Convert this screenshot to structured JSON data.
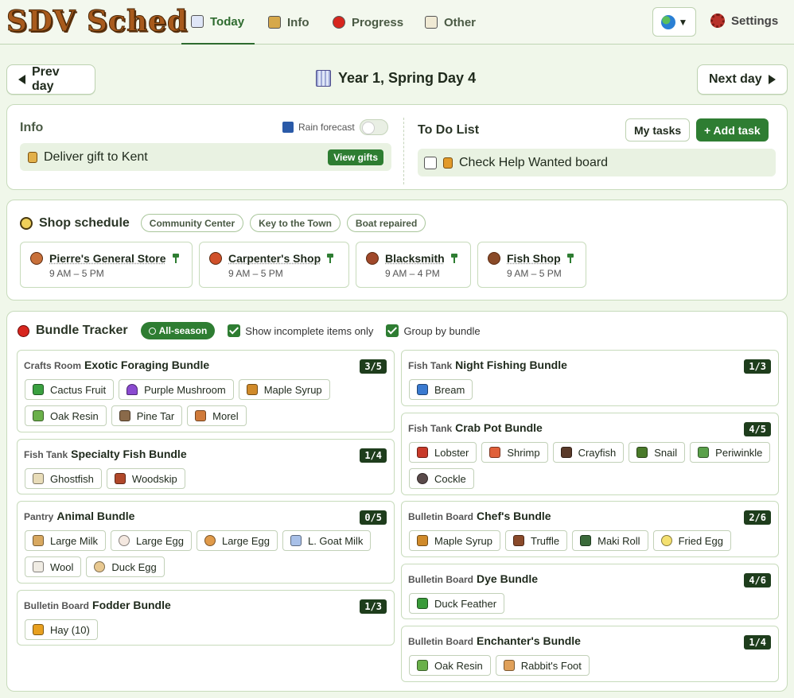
{
  "app": {
    "logo": "SDV Sched"
  },
  "nav": {
    "tabs": [
      {
        "label": "Today",
        "icon": "calendar-icon",
        "color": "#9aa3d6"
      },
      {
        "label": "Info",
        "icon": "scroll-icon",
        "color": "#d6a84a"
      },
      {
        "label": "Progress",
        "icon": "red-ball-icon",
        "color": "#d7261e"
      },
      {
        "label": "Other",
        "icon": "speech-bubble-icon",
        "color": "#e8e0c8"
      }
    ],
    "settings": "Settings"
  },
  "daybar": {
    "prev": "Prev day",
    "next": "Next day",
    "date": "Year 1, Spring Day 4"
  },
  "info": {
    "title": "Info",
    "rain_label": "Rain forecast",
    "rain_on": false,
    "gift_text": "Deliver gift to Kent",
    "view_gifts": "View gifts"
  },
  "todo": {
    "title": "To Do List",
    "my_tasks": "My tasks",
    "add_task": "+  Add task",
    "items": [
      {
        "label": "Check Help Wanted board",
        "done": false
      }
    ]
  },
  "shops": {
    "title": "Shop schedule",
    "filters": [
      "Community Center",
      "Key to the Town",
      "Boat repaired"
    ],
    "list": [
      {
        "name": "Pierre's General Store",
        "hours": "9 AM – 5 PM",
        "color": "#c8703a"
      },
      {
        "name": "Carpenter's Shop",
        "hours": "9 AM – 5 PM",
        "color": "#d0502a"
      },
      {
        "name": "Blacksmith",
        "hours": "9 AM – 4 PM",
        "color": "#a0482a"
      },
      {
        "name": "Fish Shop",
        "hours": "9 AM – 5 PM",
        "color": "#8a4a28"
      }
    ]
  },
  "bundles": {
    "title": "Bundle Tracker",
    "season": "All-season",
    "show_incomplete": "Show incomplete items only",
    "group_by": "Group by bundle",
    "left": [
      {
        "room": "Crafts Room",
        "name": "Exotic Foraging Bundle",
        "count": "3/5",
        "items": [
          {
            "label": "Cactus Fruit",
            "color": "#3aa040"
          },
          {
            "label": "Purple Mushroom",
            "color": "#8a4ad0"
          },
          {
            "label": "Maple Syrup",
            "color": "#d08a2a"
          },
          {
            "label": "Oak Resin",
            "color": "#6ab04a"
          },
          {
            "label": "Pine Tar",
            "color": "#8a6a4a"
          },
          {
            "label": "Morel",
            "color": "#d07a3a"
          }
        ]
      },
      {
        "room": "Fish Tank",
        "name": "Specialty Fish Bundle",
        "count": "1/4",
        "items": [
          {
            "label": "Ghostfish",
            "color": "#e8dcb8"
          },
          {
            "label": "Woodskip",
            "color": "#b0482a"
          }
        ]
      },
      {
        "room": "Pantry",
        "name": "Animal Bundle",
        "count": "0/5",
        "items": [
          {
            "label": "Large Milk",
            "color": "#d8a860"
          },
          {
            "label": "Large Egg",
            "color": "#f4e8e0"
          },
          {
            "label": "Large Egg",
            "color": "#e09a4a"
          },
          {
            "label": "L. Goat Milk",
            "color": "#a8c0e8"
          },
          {
            "label": "Wool",
            "color": "#f0ece4"
          },
          {
            "label": "Duck Egg",
            "color": "#e8c890"
          }
        ]
      },
      {
        "room": "Bulletin Board",
        "name": "Fodder Bundle",
        "count": "1/3",
        "items": [
          {
            "label": "Hay (10)",
            "color": "#e8a020"
          }
        ]
      }
    ],
    "right": [
      {
        "room": "Fish Tank",
        "name": "Night Fishing Bundle",
        "count": "1/3",
        "items": [
          {
            "label": "Bream",
            "color": "#3a7ad0"
          }
        ]
      },
      {
        "room": "Fish Tank",
        "name": "Crab Pot Bundle",
        "count": "4/5",
        "items": [
          {
            "label": "Lobster",
            "color": "#c83a2a"
          },
          {
            "label": "Shrimp",
            "color": "#e0603a"
          },
          {
            "label": "Crayfish",
            "color": "#5a3a2a"
          },
          {
            "label": "Snail",
            "color": "#4a7a2a"
          },
          {
            "label": "Periwinkle",
            "color": "#5aa04a"
          },
          {
            "label": "Cockle",
            "color": "#5a4a4a"
          }
        ]
      },
      {
        "room": "Bulletin Board",
        "name": "Chef's Bundle",
        "count": "2/6",
        "items": [
          {
            "label": "Maple Syrup",
            "color": "#d08a2a"
          },
          {
            "label": "Truffle",
            "color": "#8a4a2a"
          },
          {
            "label": "Maki Roll",
            "color": "#3a6a3a"
          },
          {
            "label": "Fried Egg",
            "color": "#f4e070"
          }
        ]
      },
      {
        "room": "Bulletin Board",
        "name": "Dye Bundle",
        "count": "4/6",
        "items": [
          {
            "label": "Duck Feather",
            "color": "#3a9a3a"
          }
        ]
      },
      {
        "room": "Bulletin Board",
        "name": "Enchanter's Bundle",
        "count": "1/4",
        "items": [
          {
            "label": "Oak Resin",
            "color": "#6ab04a"
          },
          {
            "label": "Rabbit's Foot",
            "color": "#e0a05a"
          }
        ]
      }
    ]
  }
}
